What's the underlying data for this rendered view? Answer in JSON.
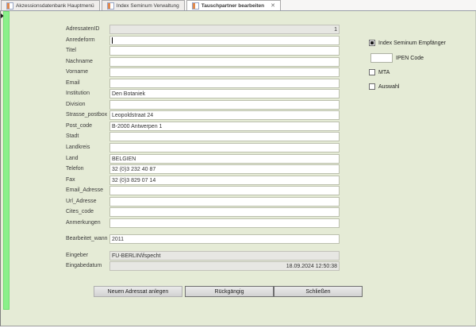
{
  "tabs": [
    {
      "label": "Akzessionsdatenbank Hauptmenü",
      "active": false
    },
    {
      "label": "Index Seminum Verwaltung",
      "active": false
    },
    {
      "label": "Tauschpartner bearbeiten",
      "active": true,
      "close_icon": "✕"
    }
  ],
  "form": {
    "fields": [
      {
        "key": "adressaten_id",
        "label": "AdressatenID",
        "value": "1",
        "disabled": true,
        "align": "right"
      },
      {
        "key": "anredeform",
        "label": "Anredeform",
        "value": "",
        "caret": true
      },
      {
        "key": "titel",
        "label": "Titel",
        "value": ""
      },
      {
        "key": "nachname",
        "label": "Nachname",
        "value": ""
      },
      {
        "key": "vorname",
        "label": "Vorname",
        "value": ""
      },
      {
        "key": "email",
        "label": "Email",
        "value": ""
      },
      {
        "key": "institution",
        "label": "Institution",
        "value": "Den Botaniek"
      },
      {
        "key": "division",
        "label": "Division",
        "value": ""
      },
      {
        "key": "strasse_postbox",
        "label": "Strasse_postbox",
        "value": "Leopoldstraat 24"
      },
      {
        "key": "post_code",
        "label": "Post_code",
        "value": "B-2000 Antwerpen 1"
      },
      {
        "key": "stadt",
        "label": "Stadt",
        "value": ""
      },
      {
        "key": "landkreis",
        "label": "Landkreis",
        "value": ""
      },
      {
        "key": "land",
        "label": "Land",
        "value": "BELGIEN"
      },
      {
        "key": "telefon",
        "label": "Telefon",
        "value": "32 (0)3 232 40 87"
      },
      {
        "key": "fax",
        "label": "Fax",
        "value": " 32 (0)3 829 07 14"
      },
      {
        "key": "email_adresse",
        "label": "Email_Adresse",
        "value": ""
      },
      {
        "key": "url_adresse",
        "label": "Url_Adresse",
        "value": ""
      },
      {
        "key": "cites_code",
        "label": "Cites_code",
        "value": ""
      },
      {
        "key": "anmerkungen",
        "label": "Anmerkungen",
        "value": ""
      },
      {
        "key": "bearbeitet_wann",
        "label": "Bearbeitet_wann",
        "value": "2011",
        "gap": 7
      },
      {
        "key": "eingeber",
        "label": "Eingeber",
        "value": "FU-BERLIN\\fspecht",
        "disabled": true,
        "gap": 7
      },
      {
        "key": "eingabedatum",
        "label": "Eingabedatum",
        "value": "18.09.2024 12:50:38",
        "disabled": true,
        "align": "right"
      }
    ]
  },
  "side_panel": {
    "index_seminum": {
      "label": "Index Seminum Empfänger",
      "checked": true
    },
    "ipen_code": {
      "label": "IPEN Code",
      "value": ""
    },
    "mta": {
      "label": "MTA",
      "checked": false
    },
    "auswahl": {
      "label": "Auswahl",
      "checked": false
    }
  },
  "buttons": [
    {
      "label": "Neuen Adressat anlegen"
    },
    {
      "label": "Rückgängig"
    },
    {
      "label": "Schließen"
    }
  ],
  "colors": {
    "form_background": "#e5ebd6",
    "record_selector_bar": "#8af08a",
    "field_border": "#bcc0ae",
    "disabled_field_background": "#e7e7e3",
    "tab_active_background": "#ffffff",
    "button_border": "#6f6f6f"
  }
}
